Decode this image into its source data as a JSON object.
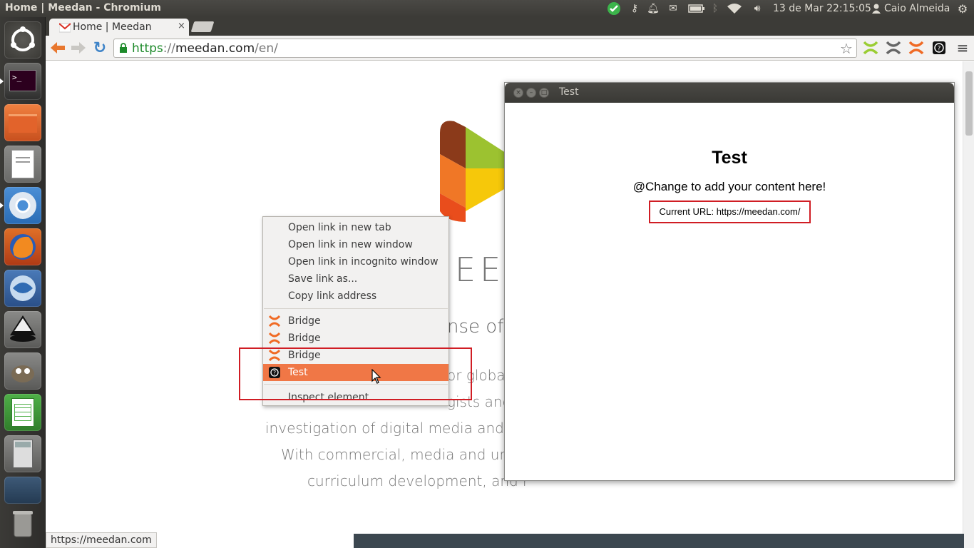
{
  "panel": {
    "window_title": "Home | Meedan - Chromium",
    "datetime": "13 de Mar 22:15:05",
    "user": "Caio Almeida"
  },
  "browser": {
    "tab_title": "Home | Meedan",
    "tab_close": "×",
    "url_scheme": "https",
    "url_sep": "://",
    "url_host": "meedan.com",
    "url_path": "/en/",
    "status_url": "https://meedan.com"
  },
  "page": {
    "logo_letters": "EE",
    "line1": "nse of",
    "line2": "or global",
    "line3": "gists and",
    "line4": "investigation of digital media and crow",
    "line5": "With commercial, media and univer",
    "line6": "curriculum development, and r"
  },
  "popup": {
    "title": "Test",
    "heading": "Test",
    "body": "@Change to add your content here!",
    "current_url": "Current URL: https://meedan.com/"
  },
  "context_menu": {
    "items": [
      {
        "label": "Open link in new tab"
      },
      {
        "label": "Open link in new window"
      },
      {
        "label": "Open link in incognito window"
      },
      {
        "label": "Save link as..."
      },
      {
        "label": "Copy link address"
      },
      {
        "label": "Bridge"
      },
      {
        "label": "Bridge"
      },
      {
        "label": "Bridge"
      },
      {
        "label": "Test"
      },
      {
        "label": "Inspect element"
      }
    ]
  },
  "colors": {
    "menu_highlight": "#f07746",
    "annotation_red": "#d01d24",
    "bridge_orange": "#f06a24",
    "bridge_green": "#9acd32"
  }
}
